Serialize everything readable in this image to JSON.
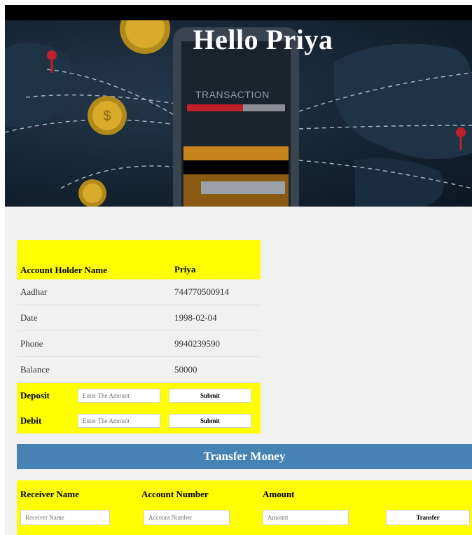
{
  "header": {
    "greeting": "Hello Priya"
  },
  "banner": {
    "phone_text": "TRANSACTION",
    "icons": [
      "coin-dollar-icon",
      "location-pin-icon"
    ]
  },
  "account": {
    "holder_label": "Account Holder Name",
    "holder_value": "Priya",
    "rows": [
      {
        "label": "Aadhar",
        "value": "744770500914"
      },
      {
        "label": "Date",
        "value": "1998-02-04"
      },
      {
        "label": "Phone",
        "value": "9940239590"
      },
      {
        "label": "Balance",
        "value": "50000"
      }
    ],
    "deposit": {
      "label": "Deposit",
      "placeholder": "Enter The Amount",
      "button": "Submit"
    },
    "debit": {
      "label": "Debit",
      "placeholder": "Enter The Amount",
      "button": "Submit"
    }
  },
  "transfer": {
    "title": "Transfer Money",
    "receiver_label": "Receiver Name",
    "receiver_placeholder": "Receiver Name",
    "account_label": "Account Number",
    "account_placeholder": "Account Number",
    "amount_label": "Amount",
    "amount_placeholder": "Amount",
    "button": "Transfer"
  },
  "colors": {
    "highlight": "#ffff00",
    "transfer_bar": "#4682b4",
    "topbar": "#000000"
  }
}
